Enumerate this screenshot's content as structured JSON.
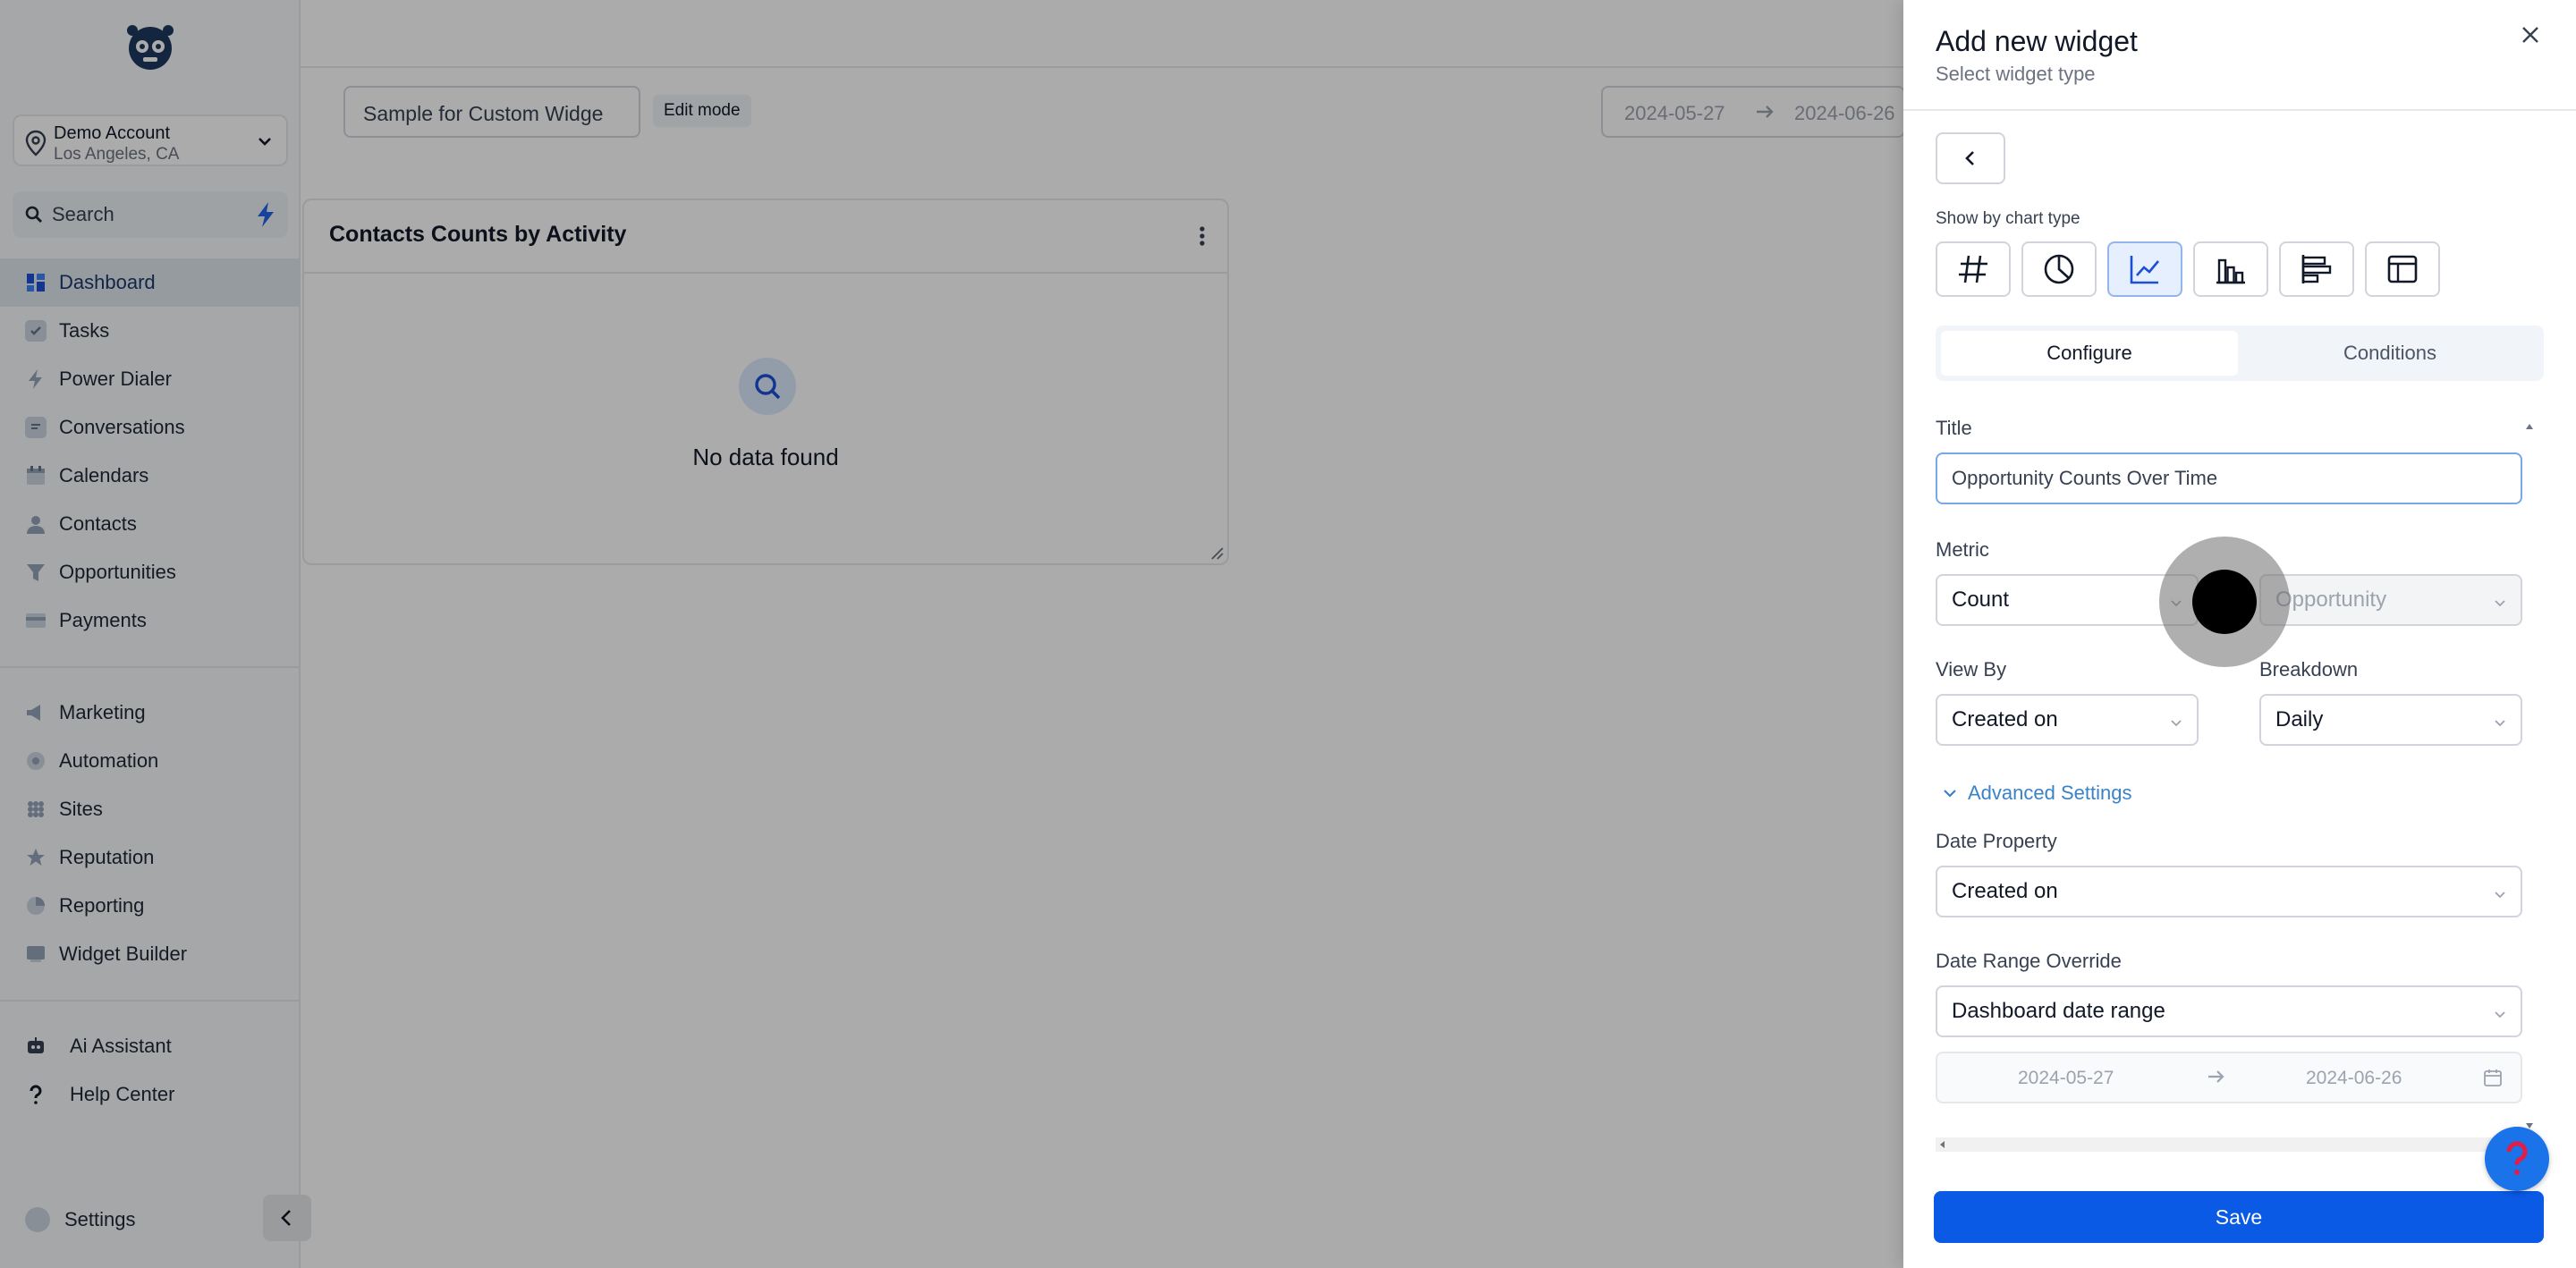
{
  "sidebar": {
    "account": {
      "name": "Demo Account",
      "location": "Los Angeles, CA"
    },
    "search": {
      "placeholder": "Search"
    },
    "group1": [
      {
        "label": "Dashboard",
        "icon": "dashboard-icon",
        "active": true
      },
      {
        "label": "Tasks",
        "icon": "tasks-icon"
      },
      {
        "label": "Power Dialer",
        "icon": "bolt-icon"
      },
      {
        "label": "Conversations",
        "icon": "chat-icon"
      },
      {
        "label": "Calendars",
        "icon": "calendar-icon"
      },
      {
        "label": "Contacts",
        "icon": "person-icon"
      },
      {
        "label": "Opportunities",
        "icon": "funnel-icon"
      },
      {
        "label": "Payments",
        "icon": "card-icon"
      }
    ],
    "group2": [
      {
        "label": "Marketing",
        "icon": "megaphone-icon"
      },
      {
        "label": "Automation",
        "icon": "automation-icon"
      },
      {
        "label": "Sites",
        "icon": "globe-icon"
      },
      {
        "label": "Reputation",
        "icon": "star-icon"
      },
      {
        "label": "Reporting",
        "icon": "pie-icon"
      },
      {
        "label": "Widget Builder",
        "icon": "widget-icon"
      }
    ],
    "group3": [
      {
        "label": "Ai Assistant",
        "icon": "robot-icon"
      },
      {
        "label": "Help Center",
        "icon": "question-icon"
      }
    ],
    "settings_label": "Settings"
  },
  "main": {
    "dashboard_name": "Sample for Custom Widge",
    "edit_mode_label": "Edit mode",
    "date_start": "2024-05-27",
    "date_end": "2024-06-26",
    "card": {
      "title": "Contacts Counts by Activity",
      "empty_text": "No data found"
    }
  },
  "drawer": {
    "title": "Add new widget",
    "subtitle": "Select widget type",
    "show_by_label": "Show by chart type",
    "chart_types": [
      "number-icon",
      "pie-chart-icon",
      "line-chart-icon",
      "bar-chart-icon",
      "horizontal-bar-icon",
      "table-icon"
    ],
    "selected_chart_type": "line-chart-icon",
    "tabs": {
      "configure": "Configure",
      "conditions": "Conditions"
    },
    "form": {
      "title_label": "Title",
      "title_value": "Opportunity Counts Over Time",
      "metric_label": "Metric",
      "metric_value": "Count",
      "metric_object": "Opportunity",
      "view_by_label": "View By",
      "view_by_value": "Created on",
      "breakdown_label": "Breakdown",
      "breakdown_value": "Daily",
      "advanced_label": "Advanced Settings",
      "date_property_label": "Date Property",
      "date_property_value": "Created on",
      "date_range_override_label": "Date Range Override",
      "date_range_override_value": "Dashboard date range",
      "range_start": "2024-05-27",
      "range_end": "2024-06-26"
    },
    "save_label": "Save"
  },
  "colors": {
    "primary": "#0a5ae6",
    "accent_link": "#3b82c6",
    "active_nav": "#e0e7ef"
  }
}
